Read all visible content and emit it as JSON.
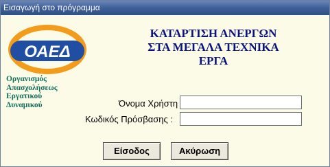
{
  "window": {
    "title": "Εισαγωγή στο πρόγραμμα"
  },
  "logo": {
    "text": "ΟΑΕΔ",
    "colors": {
      "ring": "#f39b1a",
      "blue": "#1f4ea3"
    }
  },
  "organization": {
    "lines": [
      "Οργανισμός",
      "Απασχολήσεως",
      "Εργατικού",
      "Δυναμικού"
    ]
  },
  "heading": {
    "lines": [
      "ΚΑΤΑΡΤΙΣΗ ΑΝΕΡΓΩΝ",
      "ΣΤΑ ΜΕΓΑΛΑ ΤΕΧΝΙΚΑ",
      "ΕΡΓΑ"
    ]
  },
  "form": {
    "username_label": "Όνομα Χρήστη :",
    "username_value": "",
    "password_label": "Κωδικός Πρόσβασης :",
    "password_value": ""
  },
  "buttons": {
    "login": "Είσοδος",
    "cancel": "Ακύρωση"
  }
}
